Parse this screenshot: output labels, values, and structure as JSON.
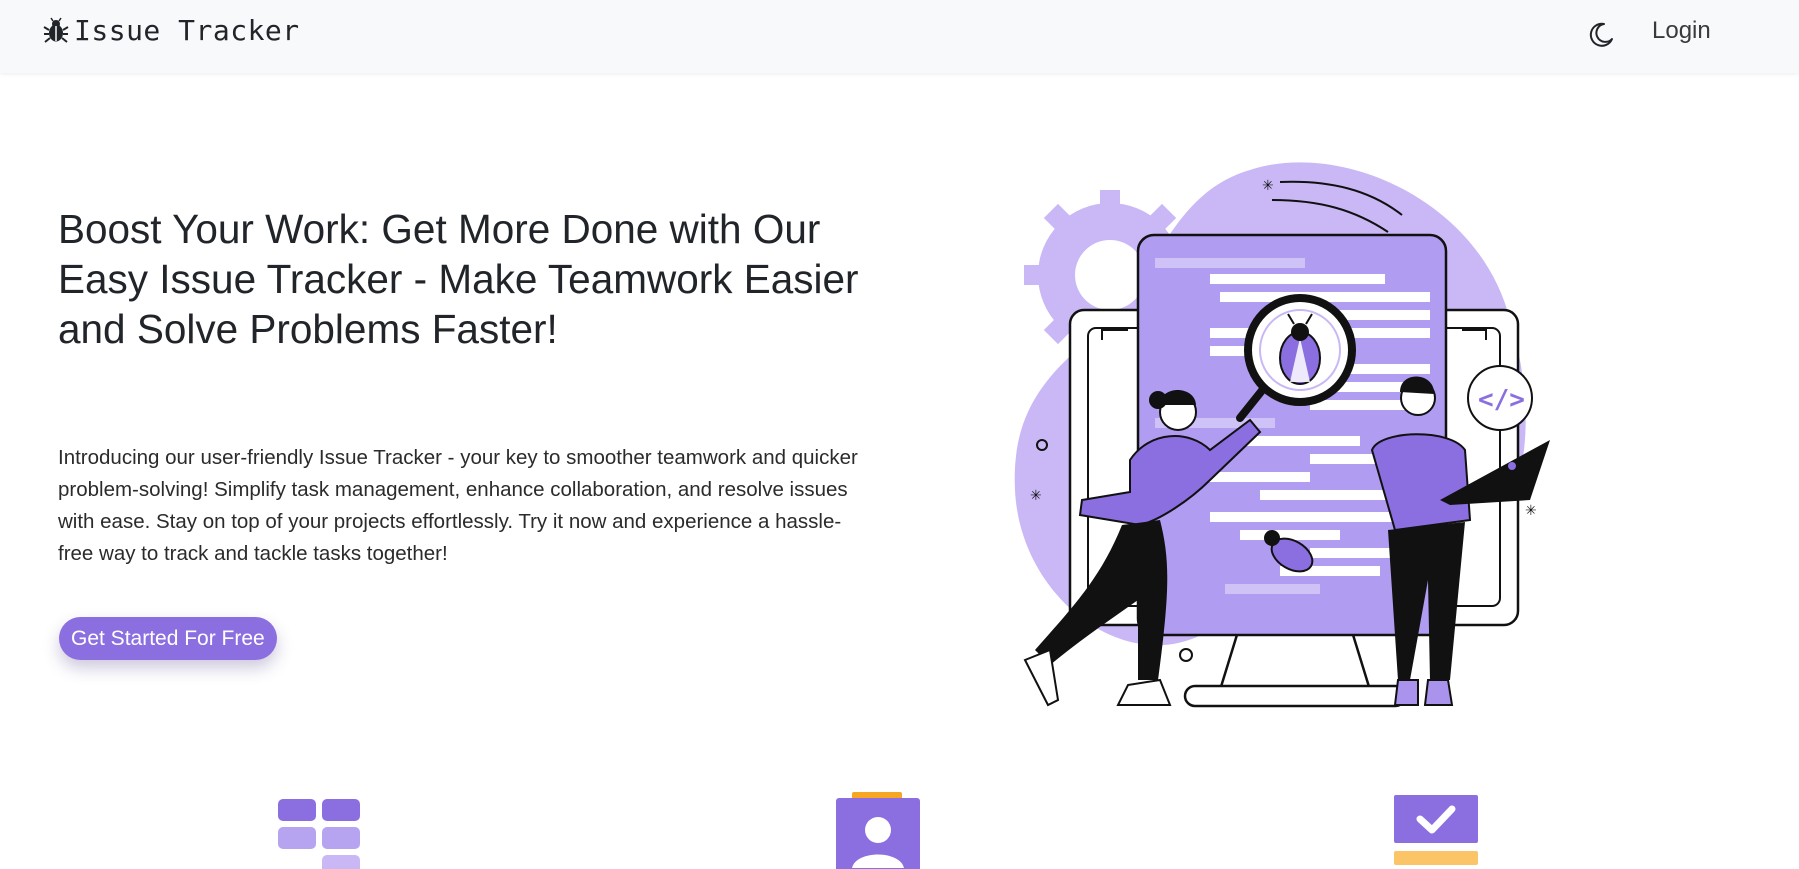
{
  "navbar": {
    "brand_icon": "bug-icon",
    "brand_text": "Issue Tracker",
    "theme_toggle_icon": "moon-icon",
    "login_label": "Login"
  },
  "hero": {
    "title": "Boost Your Work: Get More Done with Our Easy Issue Tracker - Make Teamwork Easier and Solve Problems Faster!",
    "description": "Introducing our user-friendly Issue Tracker - your key to smoother teamwork and quicker problem-solving! Simplify task management, enhance collaboration, and resolve issues with ease. Stay on top of your projects effortlessly. Try it now and experience a hassle-free way to track and tackle tasks together!",
    "cta_label": "Get Started For Free",
    "illustration": "bug-hunting-team-illustration"
  },
  "features": {
    "icons": [
      "grid-tiles-icon",
      "user-badge-icon",
      "checkbox-icon"
    ]
  },
  "colors": {
    "accent": "#8b6fe0",
    "accent_light": "#c9b8f5",
    "accent_mid": "#a993ec",
    "highlight": "#f6a623",
    "navbar_bg": "#f8f9fa"
  }
}
